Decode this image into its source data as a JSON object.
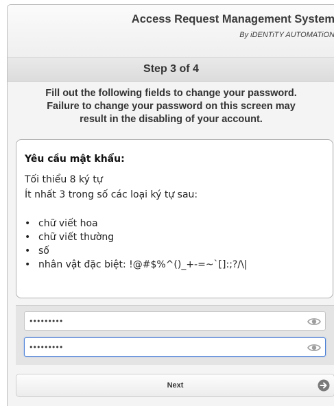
{
  "header": {
    "title": "Access Request Management System",
    "subtitle": "By iDENTiTY AUTOMATiON"
  },
  "step": {
    "label": "Step 3 of 4"
  },
  "instructions": {
    "lines": [
      "Fill out the following fields to change your password.",
      "Failure to change your password on this screen may",
      "result in the disabling of your account."
    ]
  },
  "requirements": {
    "title": "Yêu cầu mật khẩu:",
    "min_length": "Tối thiểu 8 ký tự",
    "categories_intro": "Ít nhất 3 trong số các loại ký tự sau:",
    "items": [
      "chữ viết hoa",
      "chữ viết thường",
      "số",
      "nhân vật đặc biệt:  !@#$%^()_+-=~`[]:;?/\\|"
    ],
    "bullet": "•"
  },
  "password_fields": [
    {
      "value": "•••••••••",
      "icon": "eye-icon"
    },
    {
      "value": "•••••••••",
      "icon": "eye-icon",
      "focused": true
    }
  ],
  "actions": {
    "next_label": "Next",
    "next_icon": "arrow-right-circle-icon"
  },
  "colors": {
    "focus_border": "#4a7fd6",
    "panel_bg": "#e4e4e4",
    "icon_gray": "#9e9e9e",
    "arrow_gray": "#7a7a7a"
  }
}
